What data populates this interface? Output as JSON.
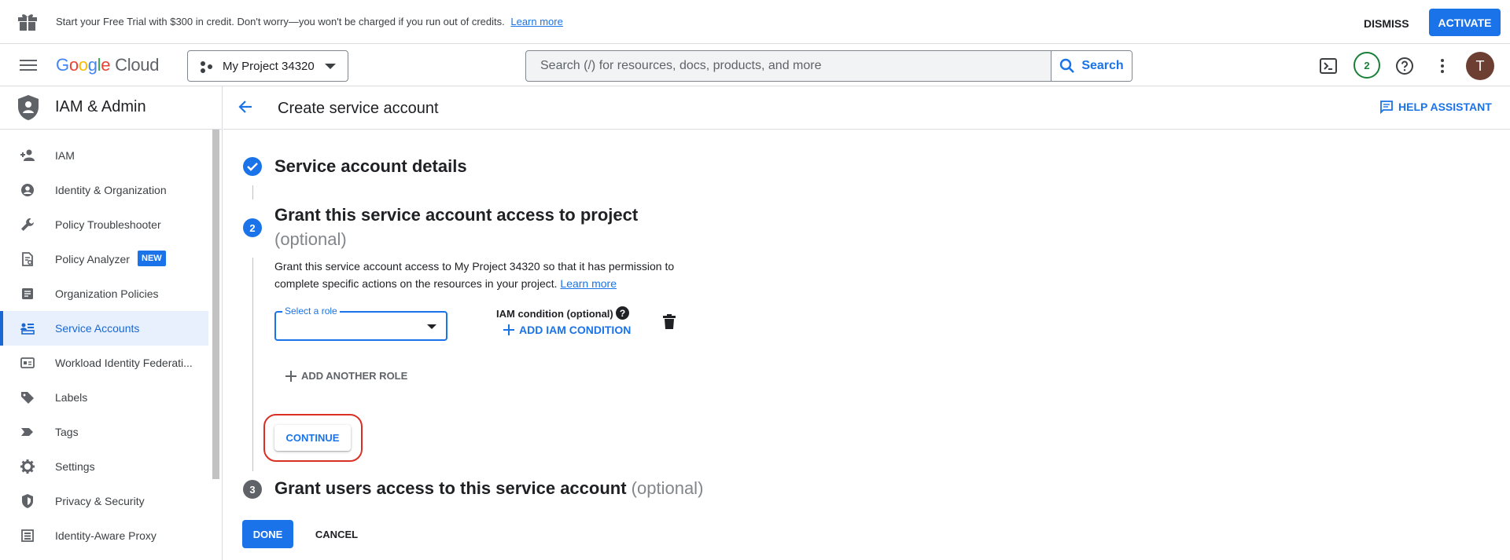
{
  "banner": {
    "message": "Start your Free Trial with $300 in credit. Don't worry—you won't be charged if you run out of credits.",
    "learn_more": "Learn more",
    "dismiss": "DISMISS",
    "activate": "ACTIVATE"
  },
  "topbar": {
    "logo_google": "Google",
    "logo_cloud": "Cloud",
    "project": "My Project 34320",
    "search_placeholder": "Search (/) for resources, docs, products, and more",
    "search_button": "Search",
    "notifications_count": "2",
    "avatar_initial": "T"
  },
  "sidebar": {
    "title": "IAM & Admin",
    "items": [
      {
        "label": "IAM",
        "icon": "person-add-icon"
      },
      {
        "label": "Identity & Organization",
        "icon": "account-circle-icon"
      },
      {
        "label": "Policy Troubleshooter",
        "icon": "wrench-icon"
      },
      {
        "label": "Policy Analyzer",
        "icon": "policy-doc-icon",
        "badge": "NEW"
      },
      {
        "label": "Organization Policies",
        "icon": "article-icon"
      },
      {
        "label": "Service Accounts",
        "icon": "service-account-icon",
        "active": true
      },
      {
        "label": "Workload Identity Federati...",
        "icon": "id-card-icon"
      },
      {
        "label": "Labels",
        "icon": "label-icon"
      },
      {
        "label": "Tags",
        "icon": "tag-icon"
      },
      {
        "label": "Settings",
        "icon": "gear-icon"
      },
      {
        "label": "Privacy & Security",
        "icon": "shield-icon"
      },
      {
        "label": "Identity-Aware Proxy",
        "icon": "proxy-icon"
      }
    ]
  },
  "page": {
    "title": "Create service account",
    "help_assistant": "HELP ASSISTANT"
  },
  "steps": {
    "step1_title": "Service account details",
    "step2_number": "2",
    "step2_title": "Grant this service account access to project",
    "step2_optional": "(optional)",
    "step2_desc": "Grant this service account access to My Project 34320 so that it has permission to complete specific actions on the resources in your project.",
    "step2_learn_more": "Learn more",
    "role_label": "Select a role",
    "iam_condition_label": "IAM condition (optional)",
    "add_iam_condition": "ADD IAM CONDITION",
    "add_another_role": "ADD ANOTHER ROLE",
    "continue": "CONTINUE",
    "step3_number": "3",
    "step3_title": "Grant users access to this service account",
    "step3_optional": "(optional)"
  },
  "actions": {
    "done": "DONE",
    "cancel": "CANCEL"
  },
  "colors": {
    "primary": "#1a73e8",
    "highlight_ring": "#d93025",
    "active_bg": "#e8f0fe"
  }
}
